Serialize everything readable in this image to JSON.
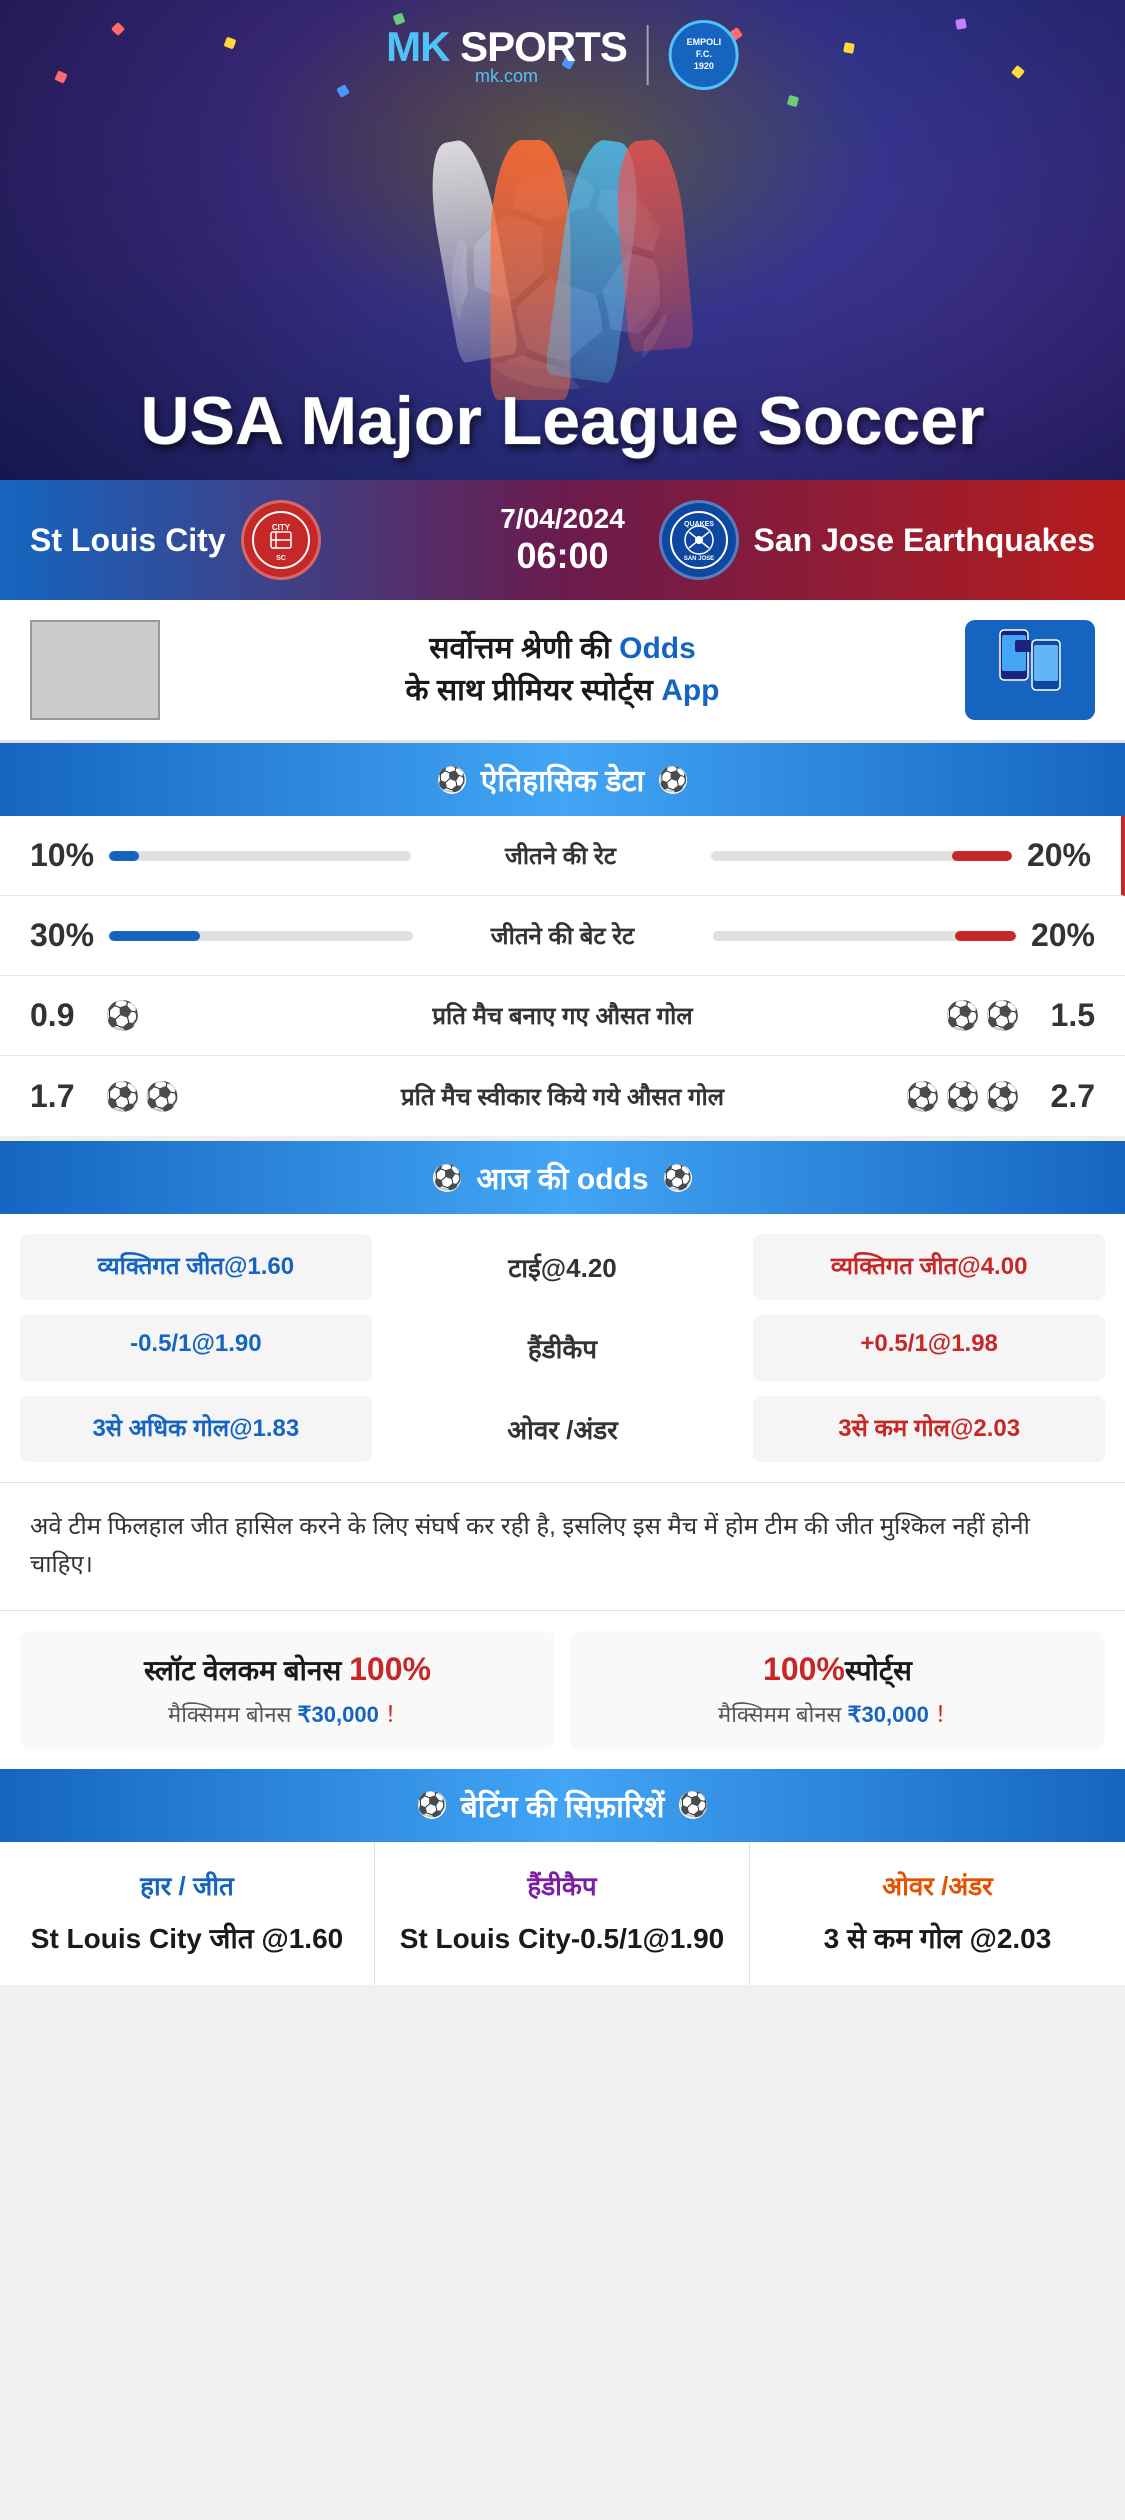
{
  "brand": {
    "name": "MK",
    "sports": "SPORTS",
    "domain": "mk.com",
    "empoli_label": "EMPOLI F.C.\n1920"
  },
  "banner": {
    "title": "USA Major League Soccer"
  },
  "match": {
    "date": "7/04/2024",
    "time": "06:00",
    "home_team": "St Louis City",
    "away_team": "San Jose Earthquakes",
    "home_logo": "STL",
    "away_logo": "QUAKES"
  },
  "promo": {
    "text": "सर्वोत्तम श्रेणी की",
    "highlight": "Odds",
    "text2": "के साथ प्रीमियर स्पोर्ट्स",
    "highlight2": "App"
  },
  "sections": {
    "historical": "ऐतिहासिक डेटा",
    "odds": "आज की odds",
    "betting": "बेटिंग की सिफ़ारिशें"
  },
  "stats": [
    {
      "label": "जीतने की रेट",
      "left_value": "10%",
      "right_value": "20%",
      "left_bar": 10,
      "right_bar": 20,
      "type": "bar"
    },
    {
      "label": "जीतने की बेट रेट",
      "left_value": "30%",
      "right_value": "20%",
      "left_bar": 30,
      "right_bar": 20,
      "type": "bar"
    },
    {
      "label": "प्रति मैच बनाए गए औसत गोल",
      "left_value": "0.9",
      "right_value": "1.5",
      "left_balls": 1,
      "right_balls": 2,
      "type": "ball"
    },
    {
      "label": "प्रति मैच स्वीकार किये गये औसत गोल",
      "left_value": "1.7",
      "right_value": "2.7",
      "left_balls": 2,
      "right_balls": 3,
      "type": "ball"
    }
  ],
  "odds": {
    "row1": {
      "left": "व्यक्तिगत जीत@1.60",
      "center": "टाई@4.20",
      "right": "व्यक्तिगत जीत@4.00"
    },
    "row2": {
      "left": "-0.5/1@1.90",
      "center": "हैंडीकैप",
      "right": "+0.5/1@1.98"
    },
    "row3": {
      "left": "3से अधिक गोल@1.83",
      "center": "ओवर /अंडर",
      "right": "3से कम गोल@2.03"
    }
  },
  "analysis": "अवे टीम फिलहाल जीत हासिल करने के लिए संघर्ष कर रही है, इसलिए इस मैच में होम टीम की जीत मुश्किल नहीं होनी चाहिए।",
  "bonus": {
    "card1_title": "स्लॉट वेलकम बोनस ",
    "card1_percent": "100%",
    "card1_sub": "मैक्सिमम बोनस ₹30,000",
    "card2_title": "100%",
    "card2_title2": "स्पोर्ट्स",
    "card2_sub": "मैक्सिमम बोनस  ₹30,000"
  },
  "recommendations": {
    "col1_title": "हार / जीत",
    "col1_value": "St Louis City जीत @1.60",
    "col2_title": "हैंडीकैप",
    "col2_value": "St Louis City-0.5/1@1.90",
    "col3_title": "ओवर /अंडर",
    "col3_value": "3 से कम गोल @2.03"
  }
}
